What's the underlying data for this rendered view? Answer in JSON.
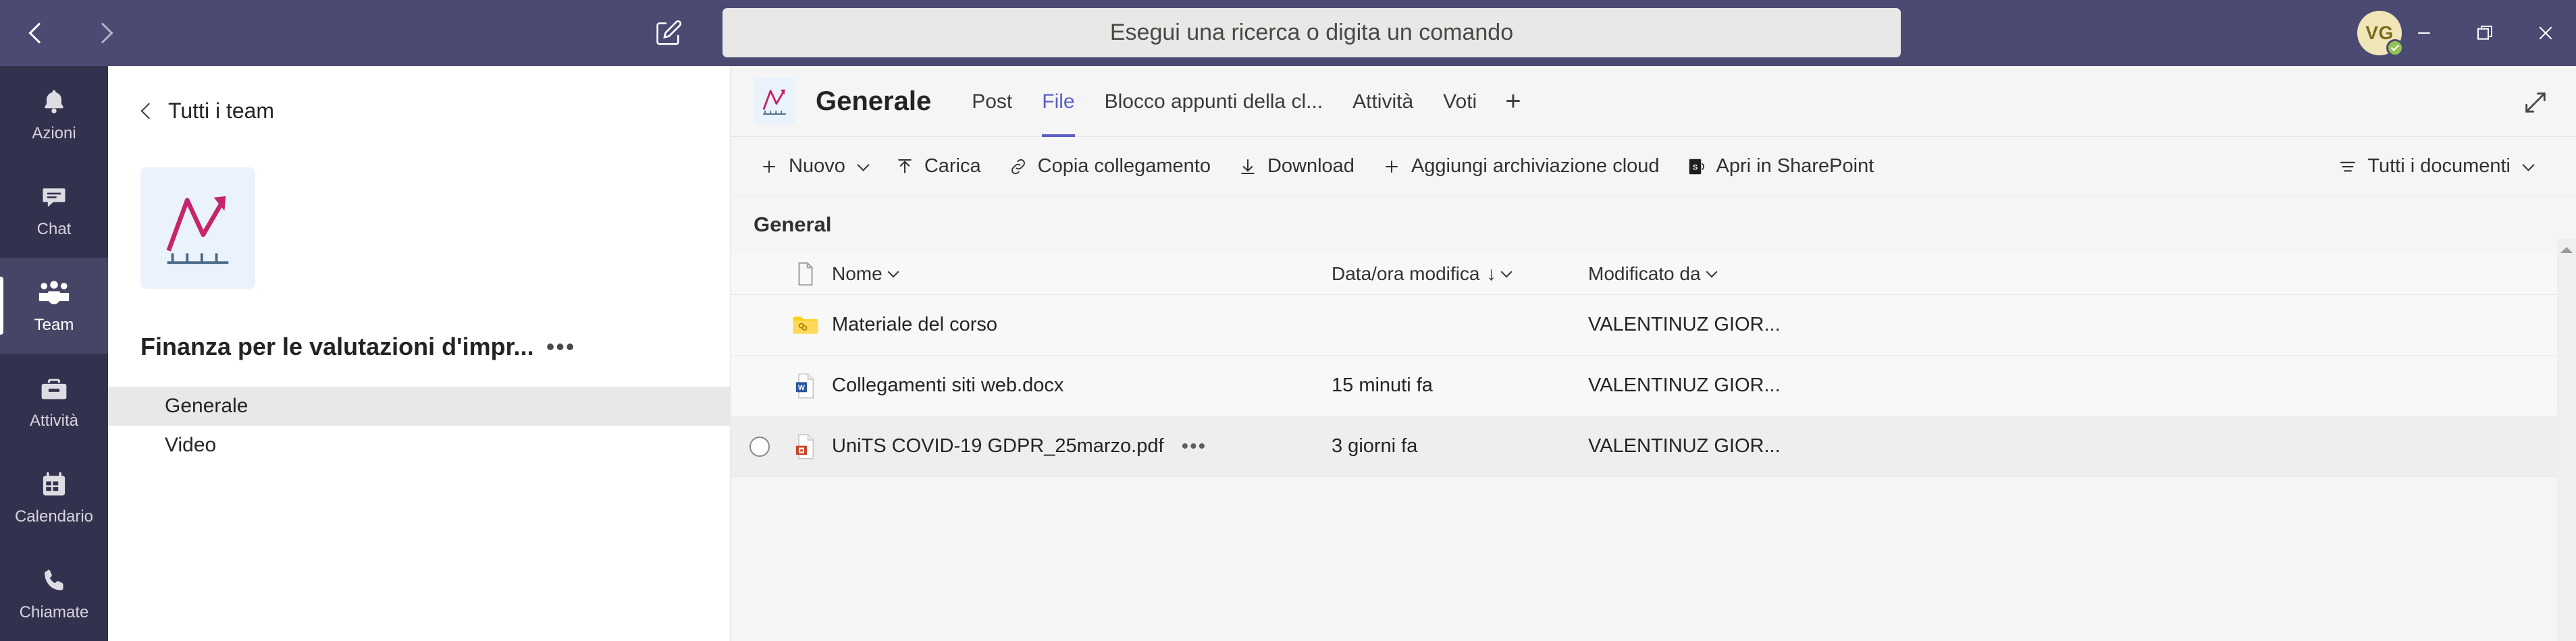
{
  "titlebar": {
    "back_icon": "chevron-left-icon",
    "forward_icon": "chevron-right-icon",
    "compose_icon": "compose-edit-icon",
    "search_placeholder": "Esegui una ricerca o digita un comando",
    "avatar_initials": "VG",
    "presence": "available",
    "minimize_label": "Riduci a icona",
    "restore_label": "Ripristina",
    "close_label": "Chiudi",
    "background": "#4b4a72"
  },
  "rail": {
    "items": [
      {
        "label": "Azioni",
        "icon": "bell-icon",
        "active": false
      },
      {
        "label": "Chat",
        "icon": "chat-icon",
        "active": false
      },
      {
        "label": "Team",
        "icon": "teams-people-icon",
        "active": true
      },
      {
        "label": "Attività",
        "icon": "briefcase-icon",
        "active": false
      },
      {
        "label": "Calendario",
        "icon": "calendar-icon",
        "active": false
      },
      {
        "label": "Chiamate",
        "icon": "phone-icon",
        "active": false
      }
    ]
  },
  "teampanel": {
    "all_teams_label": "Tutti i team",
    "back_icon": "chevron-left-icon",
    "team_avatar_icon": "growth-chart-icon",
    "team_name": "Finanza per le valutazioni d'impr...",
    "more_options_icon": "more-options-icon",
    "channels": [
      {
        "label": "Generale",
        "active": true
      },
      {
        "label": "Video",
        "active": false
      }
    ]
  },
  "content": {
    "channel_avatar_icon": "growth-chart-icon",
    "channel_name": "Generale",
    "expand_icon": "expand-arrows-icon",
    "tabs": [
      {
        "label": "Post",
        "active": false
      },
      {
        "label": "File",
        "active": true
      },
      {
        "label": "Blocco appunti della cl...",
        "active": false
      },
      {
        "label": "Attività",
        "active": false
      },
      {
        "label": "Voti",
        "active": false
      }
    ],
    "tab_add_label": "+",
    "accent_color": "#5b5fc7",
    "toolbar": {
      "left": [
        {
          "label": "Nuovo",
          "icon": "plus-icon",
          "has_chevron": true
        },
        {
          "label": "Carica",
          "icon": "upload-icon",
          "has_chevron": false
        },
        {
          "label": "Copia collegamento",
          "icon": "link-icon",
          "has_chevron": false
        },
        {
          "label": "Download",
          "icon": "download-icon",
          "has_chevron": false
        },
        {
          "label": "Aggiungi archiviazione cloud",
          "icon": "plus-icon",
          "has_chevron": false
        },
        {
          "label": "Apri in SharePoint",
          "icon": "sharepoint-icon",
          "has_chevron": false
        }
      ],
      "right": [
        {
          "label": "Tutti i documenti",
          "icon": "list-view-icon",
          "has_chevron": true
        }
      ]
    },
    "breadcrumb": "General",
    "table": {
      "columns": {
        "icon_header": "file-type-icon",
        "name": "Nome",
        "modified": "Data/ora modifica",
        "modified_by": "Modificato da",
        "sort_indicator": "↓"
      },
      "rows": [
        {
          "icon": "folder-shared-icon",
          "name": "Materiale del corso",
          "modified": "",
          "modified_by": "VALENTINUZ GIOR...",
          "hover": false,
          "selectable": false,
          "show_dots": false
        },
        {
          "icon": "word-doc-icon",
          "name": "Collegamenti siti web.docx",
          "modified": "15 minuti fa",
          "modified_by": "VALENTINUZ GIOR...",
          "hover": false,
          "selectable": false,
          "show_dots": false
        },
        {
          "icon": "pdf-icon",
          "name": "UniTS COVID-19 GDPR_25marzo.pdf",
          "modified": "3 giorni fa",
          "modified_by": "VALENTINUZ GIOR...",
          "hover": true,
          "selectable": true,
          "show_dots": true
        }
      ]
    },
    "scroll_up_icon": "scroll-up-arrow"
  }
}
